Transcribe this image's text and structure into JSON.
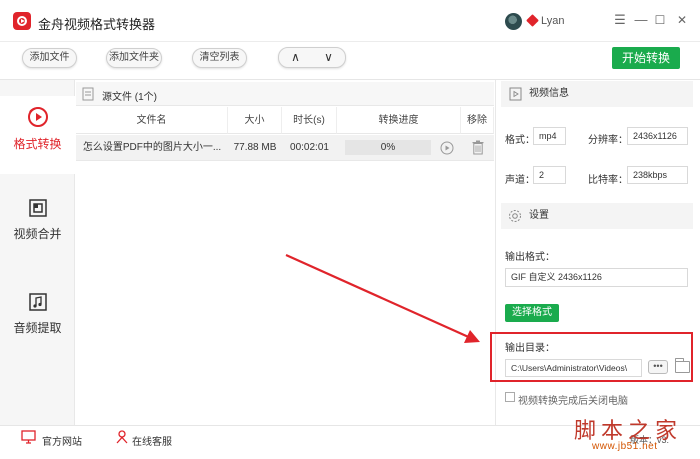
{
  "app": {
    "title": "金舟视频格式转换器",
    "username": "Lyan"
  },
  "window_controls": {
    "menu": "☰",
    "minimize": "—",
    "maximize": "☐",
    "close": "✕"
  },
  "toolbar": {
    "add_file": "添加文件",
    "add_folder": "添加文件夹",
    "clear_list": "清空列表",
    "move_up": "∧",
    "move_down": "∨",
    "start": "开始转换"
  },
  "nav": {
    "items": [
      {
        "label": "格式转换",
        "icon": "format-convert-icon",
        "active": true
      },
      {
        "label": "视频合并",
        "icon": "video-merge-icon",
        "active": false
      },
      {
        "label": "音频提取",
        "icon": "audio-extract-icon",
        "active": false
      }
    ]
  },
  "file_list": {
    "header": "源文件 (1个)",
    "columns": [
      "文件名",
      "大小",
      "时长(s)",
      "转换进度",
      "移除"
    ],
    "rows": [
      {
        "name": "怎么设置PDF中的图片大小一...",
        "size": "77.88 MB",
        "duration": "00:02:01",
        "progress_text": "0%",
        "progress": 0
      }
    ]
  },
  "video_info": {
    "title": "视频信息",
    "format_label": "格式：",
    "format_value": "mp4",
    "resolution_label": "分辨率：",
    "resolution_value": "2436x1126",
    "channels_label": "声道：",
    "channels_value": "2",
    "bitrate_label": "比特率：",
    "bitrate_value": "238kbps"
  },
  "settings": {
    "title": "设置",
    "output_format_label": "输出格式：",
    "output_format_value": "GIF 自定义 2436x1126",
    "choose_format": "选择格式",
    "output_dir_label": "输出目录：",
    "output_dir_value": "C:\\Users\\Administrator\\Videos\\",
    "browse": "•••",
    "shutdown_label": "视频转换完成后关闭电脑"
  },
  "footer": {
    "website": "官方网站",
    "support": "在线客服",
    "version": "版本：v3."
  },
  "watermark": {
    "big": "脚本之家",
    "small": "www.jb51.net"
  },
  "colors": {
    "brand_red": "#e0242b",
    "action_green": "#1aab4d"
  }
}
